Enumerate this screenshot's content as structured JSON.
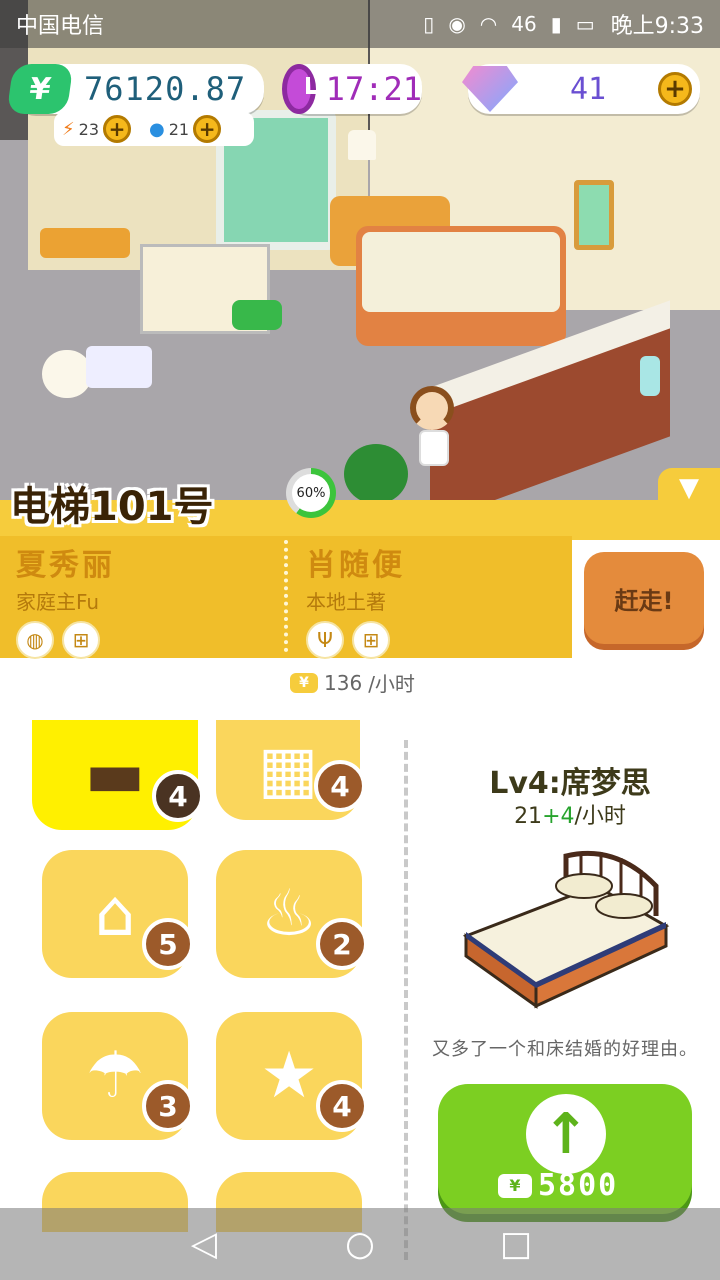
{
  "status_bar": {
    "carrier": "中国电信",
    "network": "46",
    "time": "晚上9:33"
  },
  "resources": {
    "money": "76120.87",
    "clock": "17:21",
    "gems": "41",
    "energy": "23",
    "water": "21"
  },
  "room": {
    "progress_label": "60%",
    "progress_value": 0.6,
    "elevator_title": "电梯101号"
  },
  "tenants": [
    {
      "name": "夏秀丽",
      "role": "家庭主Fu",
      "icons": [
        "toilet-paper-icon",
        "basket-icon"
      ]
    },
    {
      "name": "肖随便",
      "role": "本地土著",
      "icons": [
        "cutlery-icon",
        "basket-icon"
      ]
    }
  ],
  "kick_button": "赶走!",
  "income": {
    "amount": "136",
    "unit": "/小时"
  },
  "furniture": [
    {
      "name": "bed",
      "level": "4",
      "glyph": "▬",
      "selected": true
    },
    {
      "name": "desk",
      "level": "4",
      "glyph": "▦"
    },
    {
      "name": "range-hood",
      "level": "5",
      "glyph": "⌂"
    },
    {
      "name": "toilet",
      "level": "2",
      "glyph": "♨"
    },
    {
      "name": "shower",
      "level": "3",
      "glyph": "☂"
    },
    {
      "name": "lamp",
      "level": "4",
      "glyph": "★"
    }
  ],
  "detail": {
    "title": "Lv4:席梦思",
    "rate_base": "21",
    "rate_plus": "+4",
    "rate_unit": "/小时",
    "description": "又多了一个和床结婚的好理由。",
    "price": "5800"
  },
  "colors": {
    "accent_yellow": "#f6cc3c",
    "money_green": "#2cc46e",
    "upgrade_green": "#7ccf22"
  }
}
